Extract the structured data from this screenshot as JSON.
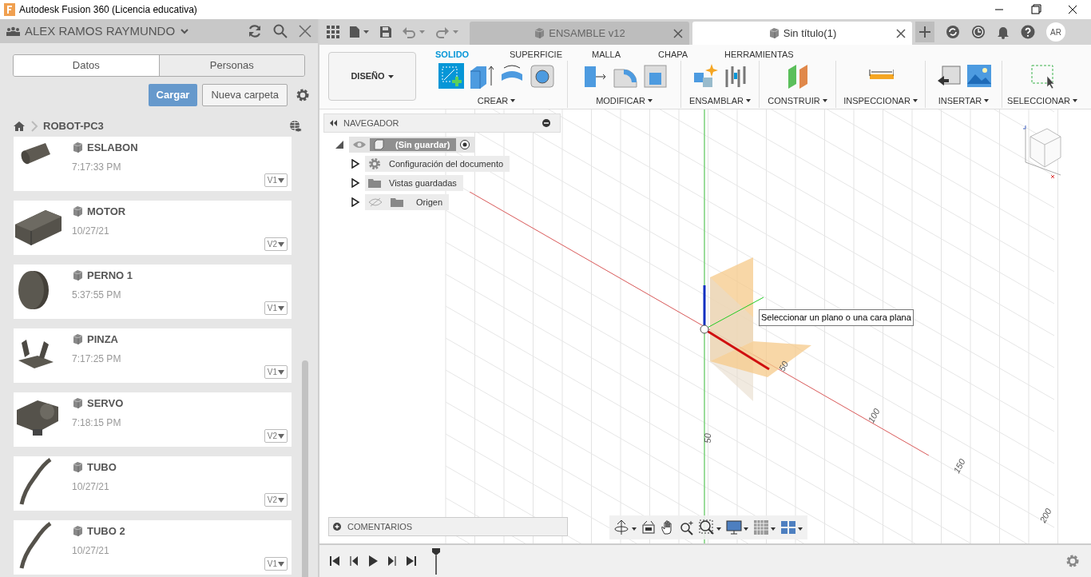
{
  "window": {
    "title": "Autodesk Fusion 360 (Licencia educativa)"
  },
  "data_panel": {
    "user": "ALEX RAMOS RAYMUNDO",
    "tabs": [
      {
        "label": "Datos",
        "selected": true
      },
      {
        "label": "Personas",
        "selected": false
      }
    ],
    "upload_button": "Cargar",
    "new_folder_button": "Nueva carpeta",
    "breadcrumb": "ROBOT-PC3",
    "files": [
      {
        "name": "ESLABON",
        "date": "7:17:33 PM",
        "version": "V1",
        "kind": "cylinder"
      },
      {
        "name": "MOTOR",
        "date": "10/27/21",
        "version": "V2",
        "kind": "box"
      },
      {
        "name": "PERNO 1",
        "date": "5:37:55 PM",
        "version": "V1",
        "kind": "disc"
      },
      {
        "name": "PINZA",
        "date": "7:17:25 PM",
        "version": "V1",
        "kind": "gripper"
      },
      {
        "name": "SERVO",
        "date": "7:18:15 PM",
        "version": "V2",
        "kind": "servo"
      },
      {
        "name": "TUBO",
        "date": "10/27/21",
        "version": "V2",
        "kind": "tube"
      },
      {
        "name": "TUBO 2",
        "date": "10/27/21",
        "version": "V1",
        "kind": "tube"
      }
    ]
  },
  "doc_tabs": [
    {
      "label": "ENSAMBLE v12",
      "selected": false
    },
    {
      "label": "Sin título(1)",
      "selected": true
    }
  ],
  "user_initials": "AR",
  "workspace": "DISEÑO",
  "ribbon_tabs": [
    {
      "label": "SOLIDO",
      "selected": true
    },
    {
      "label": "SUPERFICIE",
      "selected": false
    },
    {
      "label": "MALLA",
      "selected": false
    },
    {
      "label": "CHAPA",
      "selected": false
    },
    {
      "label": "HERRAMIENTAS",
      "selected": false
    }
  ],
  "tool_groups": [
    {
      "label": "CREAR",
      "kind": "create"
    },
    {
      "label": "MODIFICAR",
      "kind": "modify"
    },
    {
      "label": "ENSAMBLAR",
      "kind": "assemble"
    },
    {
      "label": "CONSTRUIR",
      "kind": "construct"
    },
    {
      "label": "INSPECCIONAR",
      "kind": "inspect"
    },
    {
      "label": "INSERTAR",
      "kind": "insert"
    },
    {
      "label": "SELECCIONAR",
      "kind": "select"
    }
  ],
  "browser": {
    "title": "NAVEGADOR",
    "root": {
      "label": "(Sin guardar)",
      "expanded": true
    },
    "children": [
      {
        "label": "Configuración del documento",
        "kind": "settings",
        "expanded": false
      },
      {
        "label": "Vistas guardadas",
        "kind": "folder",
        "expanded": false
      },
      {
        "label": "Origen",
        "kind": "hidden-folder",
        "expanded": false
      }
    ]
  },
  "comments": "COMENTARIOS",
  "tooltip": "Seleccionar un plano o una cara plana",
  "grid_labels": [
    {
      "text": "50"
    },
    {
      "text": "100"
    },
    {
      "text": "150"
    },
    {
      "text": "200"
    },
    {
      "text": "50"
    }
  ]
}
